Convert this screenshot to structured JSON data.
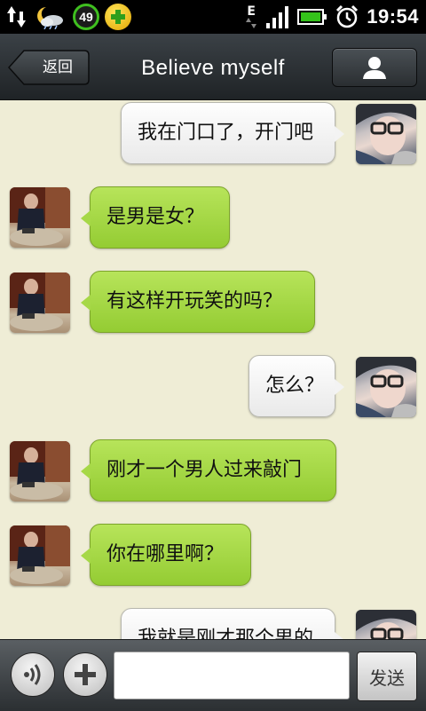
{
  "status_bar": {
    "badge_number": "49",
    "network_type": "E",
    "time": "19:54",
    "icons": [
      "data-transfer-icon",
      "weather-icon",
      "battery-saver-icon",
      "plus-app-icon",
      "signal-icon",
      "battery-icon",
      "alarm-icon"
    ]
  },
  "header": {
    "back_label": "返回",
    "title": "Believe myself",
    "profile_icon": "person-icon"
  },
  "messages": [
    {
      "side": "out",
      "text": "我在门口了，开门吧"
    },
    {
      "side": "in",
      "text": "是男是女？"
    },
    {
      "side": "in",
      "text": "有这样开玩笑的吗？"
    },
    {
      "side": "out",
      "text": "怎么？"
    },
    {
      "side": "in",
      "text": "刚才一个男人过来敲门"
    },
    {
      "side": "in",
      "text": "你在哪里啊？"
    },
    {
      "side": "out",
      "text": "我就是刚才那个男的"
    }
  ],
  "input_bar": {
    "voice_icon": "voice-icon",
    "add_icon": "plus-icon",
    "input_value": "",
    "send_label": "发送"
  },
  "colors": {
    "chat_background": "#efedd6",
    "incoming_bubble": "#a6d847",
    "outgoing_bubble": "#f3f3f3",
    "header_background": "#2c3135"
  }
}
